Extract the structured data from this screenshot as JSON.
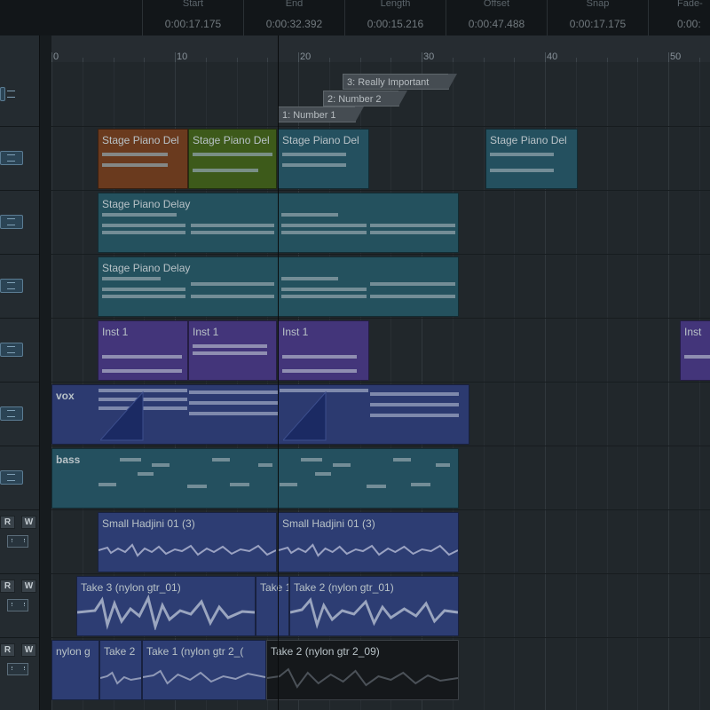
{
  "info": {
    "start_label": "Start",
    "start_value": "0:00:17.175",
    "end_label": "End",
    "end_value": "0:00:32.392",
    "length_label": "Length",
    "length_value": "0:00:15.216",
    "offset_label": "Offset",
    "offset_value": "0:00:47.488",
    "snap_label": "Snap",
    "snap_value": "0:00:17.175",
    "fade_label": "Fade-",
    "fade_value": "0:00:"
  },
  "ruler": {
    "n0": "0",
    "n10": "10",
    "n20": "20",
    "n30": "30",
    "n40": "40",
    "n50": "50"
  },
  "markers": {
    "m1": "1: Number 1",
    "m2": "2: Number 2",
    "m3": "3: Really Important"
  },
  "buttons": {
    "read": "R",
    "write": "W"
  },
  "clips": {
    "t1_a": "Stage Piano Del",
    "t1_b": "Stage Piano Del",
    "t1_c": "Stage Piano Del",
    "t1_d": "Stage Piano Del",
    "t2_a": "Stage Piano Delay",
    "t3_a": "Stage Piano Delay",
    "t4_a": "Inst 1",
    "t4_b": "Inst 1",
    "t4_c": "Inst 1",
    "t4_d": "Inst",
    "t5_a": "vox",
    "t6_a": "bass",
    "t7_a": "Small Hadjini 01 (3)",
    "t7_b": "Small Hadjini 01 (3)",
    "t8_a": "Take 3 (nylon gtr_01)",
    "t8_b": "Take 1",
    "t8_c": "Take 2 (nylon gtr_01)",
    "t9_a": "nylon g",
    "t9_b": "Take 2",
    "t9_c": "Take 1 (nylon gtr 2_(",
    "t9_d": "Take 2 (nylon gtr 2_09)"
  },
  "colors": {
    "orange": "#6a3a1e",
    "green": "#3d5a1a",
    "teal": "#24505f",
    "purple": "#43357a",
    "blue": "#2d3d73"
  }
}
